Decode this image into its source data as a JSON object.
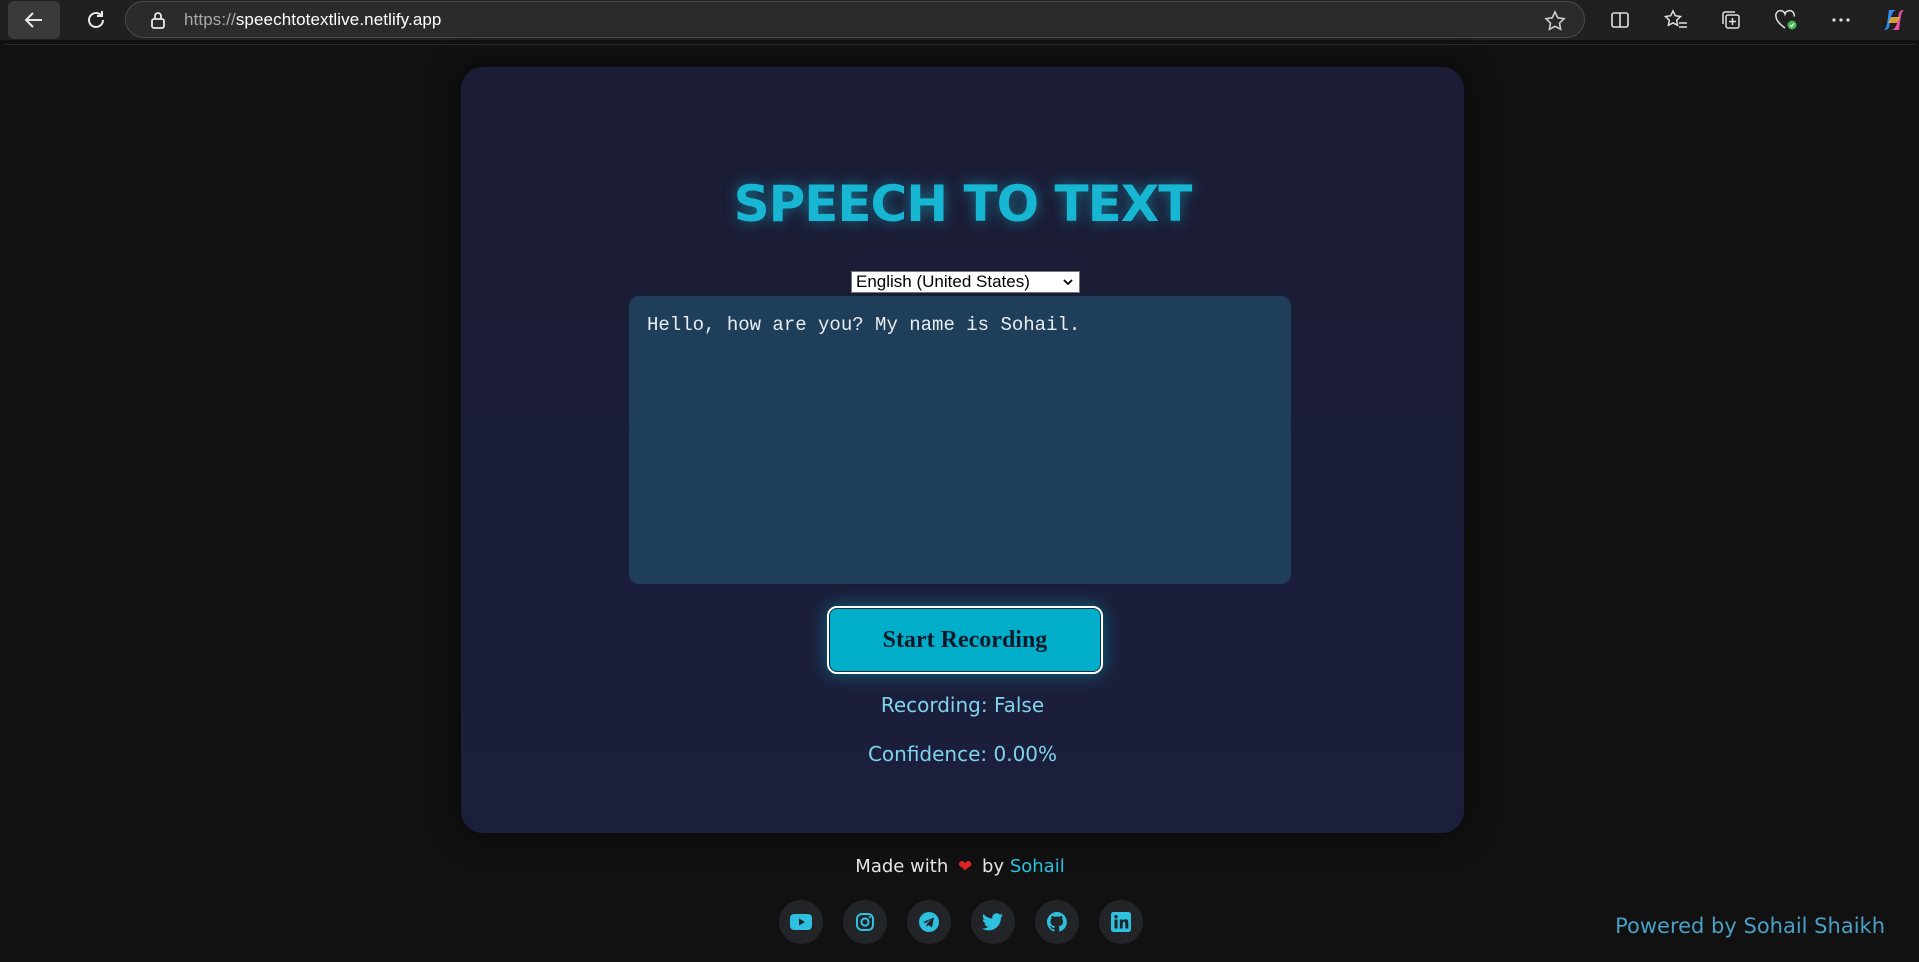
{
  "browser": {
    "url_protocol": "https://",
    "url_host": "speechtotextlive.netlify.app",
    "icons": [
      "back-icon",
      "reload-icon",
      "lock-icon",
      "star-icon",
      "split-screen-icon",
      "favorites-icon",
      "collections-icon",
      "browser-essentials-icon",
      "more-icon",
      "copilot-icon"
    ]
  },
  "app": {
    "title": "SPEECH TO TEXT",
    "language_select": {
      "selected": "English (United States)"
    },
    "transcript": "Hello, how are you? My name is Sohail.",
    "record_button": "Start Recording",
    "recording_status": "Recording: False",
    "confidence": "Confidence: 0.00%",
    "colors": {
      "accent": "#17b6d3",
      "button": "#00aec9",
      "card": "#1b1c35",
      "textarea": "#1f3e5a"
    }
  },
  "footer": {
    "made_with": "Made with",
    "heart": "❤",
    "by": "by",
    "author": "Sohail",
    "socials": [
      "youtube-icon",
      "instagram-icon",
      "telegram-icon",
      "twitter-icon",
      "github-icon",
      "linkedin-icon"
    ],
    "powered_by": "Powered by Sohail Shaikh"
  }
}
